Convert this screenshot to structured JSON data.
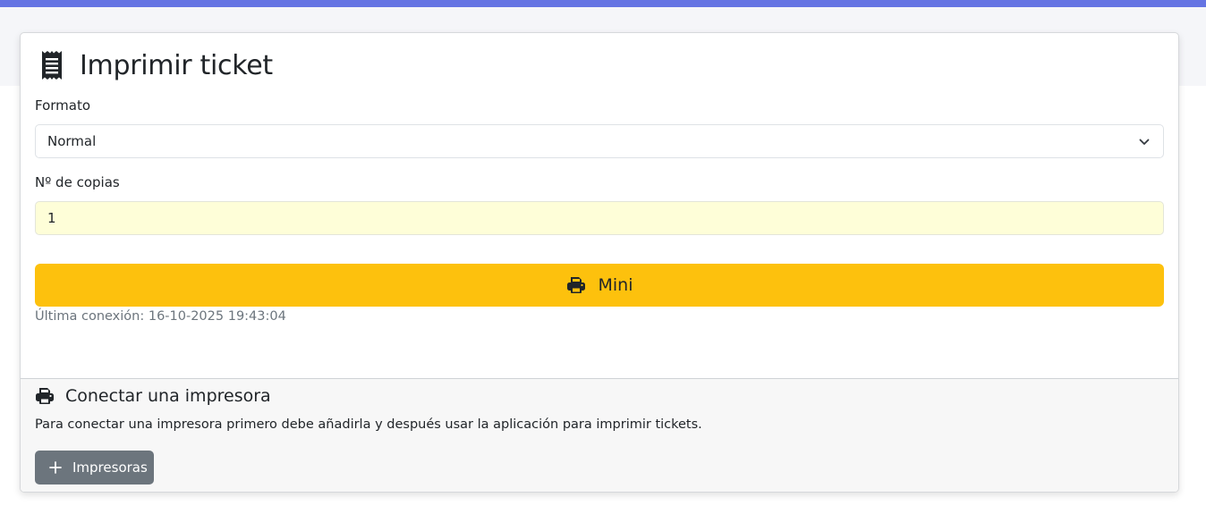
{
  "page": {
    "accent_color": "#6574e3"
  },
  "card": {
    "title": "Imprimir ticket",
    "title_icon": "receipt-icon"
  },
  "form": {
    "format_label": "Formato",
    "format_value": "Normal",
    "copies_label": "Nº de copias",
    "copies_value": "1"
  },
  "print_button": {
    "label": "Mini",
    "icon": "printer-icon",
    "color": "#fdc10d"
  },
  "last_connection": "Última conexión: 16-10-2025 19:43:04",
  "connect_section": {
    "title": "Conectar una impresora",
    "icon": "printer-icon",
    "description": "Para conectar una impresora primero debe añadirla y después usar la aplicación para imprimir tickets.",
    "button_label": "Impresoras",
    "button_icon": "plus-icon",
    "button_color": "#6c757d"
  }
}
